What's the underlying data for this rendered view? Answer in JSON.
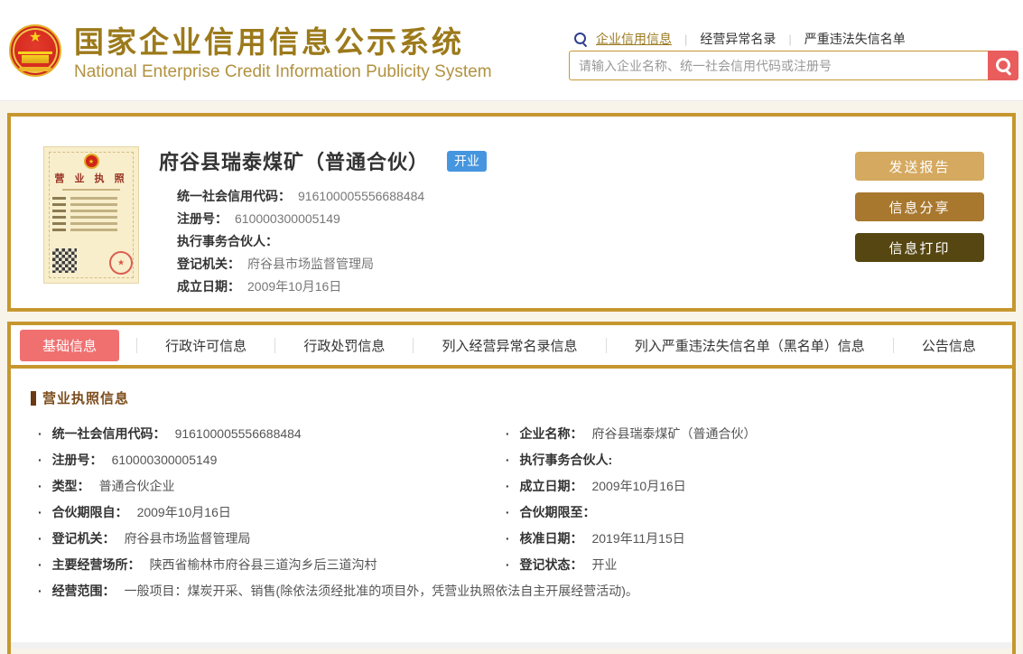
{
  "header": {
    "title_cn": "国家企业信用信息公示系统",
    "title_en": "National Enterprise Credit Information Publicity System",
    "nav": {
      "links": [
        {
          "label": "企业信用信息",
          "active": true
        },
        {
          "label": "经营异常名录",
          "active": false
        },
        {
          "label": "严重违法失信名单",
          "active": false
        }
      ]
    },
    "search": {
      "placeholder": "请输入企业名称、统一社会信用代码或注册号",
      "value": ""
    }
  },
  "company_card": {
    "license_thumb_title": "营 业 执 照",
    "name": "府谷县瑞泰煤矿（普通合伙）",
    "status_badge": "开业",
    "fields": [
      {
        "label": "统一社会信用代码：",
        "value": "916100005556688484"
      },
      {
        "label": "注册号：",
        "value": "610000300005149"
      },
      {
        "label": "执行事务合伙人：",
        "value": ""
      },
      {
        "label": "登记机关：",
        "value": "府谷县市场监督管理局"
      },
      {
        "label": "成立日期：",
        "value": "2009年10月16日"
      }
    ],
    "actions": [
      {
        "label": "发送报告",
        "color": "#d5a95f"
      },
      {
        "label": "信息分享",
        "color": "#a8782f"
      },
      {
        "label": "信息打印",
        "color": "#564712"
      }
    ]
  },
  "tabs": [
    {
      "label": "基础信息",
      "active": true
    },
    {
      "label": "行政许可信息",
      "active": false
    },
    {
      "label": "行政处罚信息",
      "active": false
    },
    {
      "label": "列入经营异常名录信息",
      "active": false
    },
    {
      "label": "列入严重违法失信名单（黑名单）信息",
      "active": false
    },
    {
      "label": "公告信息",
      "active": false
    }
  ],
  "license_section": {
    "title": "营业执照信息",
    "left_rows": [
      {
        "label": "统一社会信用代码：",
        "value": "916100005556688484"
      },
      {
        "label": "注册号：",
        "value": "610000300005149"
      },
      {
        "label": "类型：",
        "value": "普通合伙企业"
      },
      {
        "label": "合伙期限自：",
        "value": "2009年10月16日"
      },
      {
        "label": "登记机关：",
        "value": "府谷县市场监督管理局"
      },
      {
        "label": "主要经营场所：",
        "value": "陕西省榆林市府谷县三道沟乡后三道沟村"
      }
    ],
    "right_rows": [
      {
        "label": "企业名称：",
        "value": "府谷县瑞泰煤矿（普通合伙）"
      },
      {
        "label": "执行事务合伙人:",
        "value": ""
      },
      {
        "label": "成立日期：",
        "value": "2009年10月16日"
      },
      {
        "label": "合伙期限至：",
        "value": ""
      },
      {
        "label": "核准日期：",
        "value": "2019年11月15日"
      },
      {
        "label": "登记状态：",
        "value": "开业"
      }
    ],
    "full_rows": [
      {
        "label": "经营范围：",
        "value": "一般项目：煤炭开采、销售(除依法须经批准的项目外，凭营业执照依法自主开展经营活动)。"
      }
    ]
  },
  "colors": {
    "gold_border": "#c6972f",
    "cream_bg": "#f8f4ea",
    "title_gold": "#9c7a1b",
    "subtitle_gold": "#b29240",
    "link_gold": "#9a7b21",
    "nav_magnifier_blue": "#2f3f8f",
    "search_button_red": "#e95d5d",
    "status_badge_blue": "#4696df",
    "active_tab_red": "#f07070",
    "section_title_brown": "#7d4e1e",
    "btn_send_report": "#d5a95f",
    "btn_share_info": "#a8782f",
    "btn_print_info": "#564712"
  }
}
